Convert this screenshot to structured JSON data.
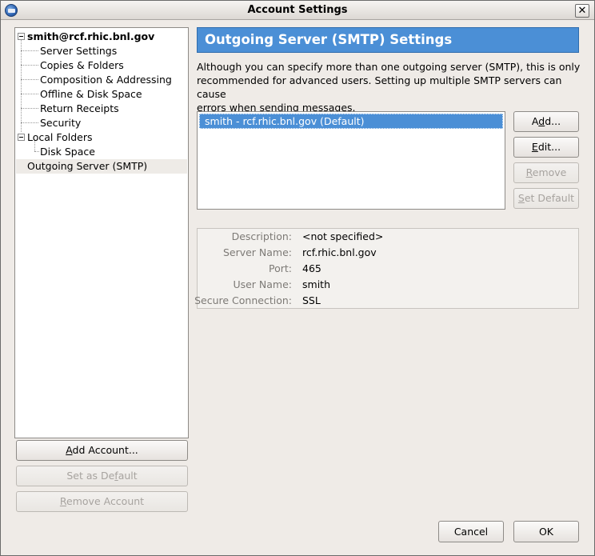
{
  "window": {
    "title": "Account Settings",
    "close_glyph": "✕"
  },
  "tree": {
    "accounts": [
      {
        "name": "smith@rcf.rhic.bnl.gov",
        "children": [
          "Server Settings",
          "Copies & Folders",
          "Composition & Addressing",
          "Offline & Disk Space",
          "Return Receipts",
          "Security"
        ]
      },
      {
        "name": "Local Folders",
        "children": [
          "Disk Space"
        ]
      }
    ],
    "outgoing": "Outgoing Server (SMTP)"
  },
  "left_buttons": {
    "add_account": {
      "pre": "",
      "key": "A",
      "post": "dd Account..."
    },
    "set_default": {
      "pre": "Set as De",
      "key": "f",
      "post": "ault"
    },
    "remove_account": {
      "pre": "",
      "key": "R",
      "post": "emove Account"
    }
  },
  "panel": {
    "title": "Outgoing Server (SMTP) Settings",
    "description_lines": [
      "Although you can specify more than one outgoing server (SMTP), this is only",
      "recommended for advanced users. Setting up multiple SMTP servers can cause",
      "errors when sending messages."
    ],
    "servers": [
      "smith - rcf.rhic.bnl.gov (Default)"
    ],
    "buttons": {
      "add": {
        "pre": "A",
        "key": "d",
        "post": "d..."
      },
      "edit": {
        "pre": "",
        "key": "E",
        "post": "dit..."
      },
      "remove": {
        "pre": "",
        "key": "R",
        "post": "emove"
      },
      "set_default": {
        "pre": "",
        "key": "S",
        "post": "et Default"
      }
    },
    "details": [
      {
        "label": "Description:",
        "value": "<not specified>"
      },
      {
        "label": "Server Name:",
        "value": "rcf.rhic.bnl.gov"
      },
      {
        "label": "Port:",
        "value": "465"
      },
      {
        "label": "User Name:",
        "value": "smith"
      },
      {
        "label": "Secure Connection:",
        "value": "SSL"
      }
    ]
  },
  "dialog_buttons": {
    "cancel": "Cancel",
    "ok": "OK"
  }
}
